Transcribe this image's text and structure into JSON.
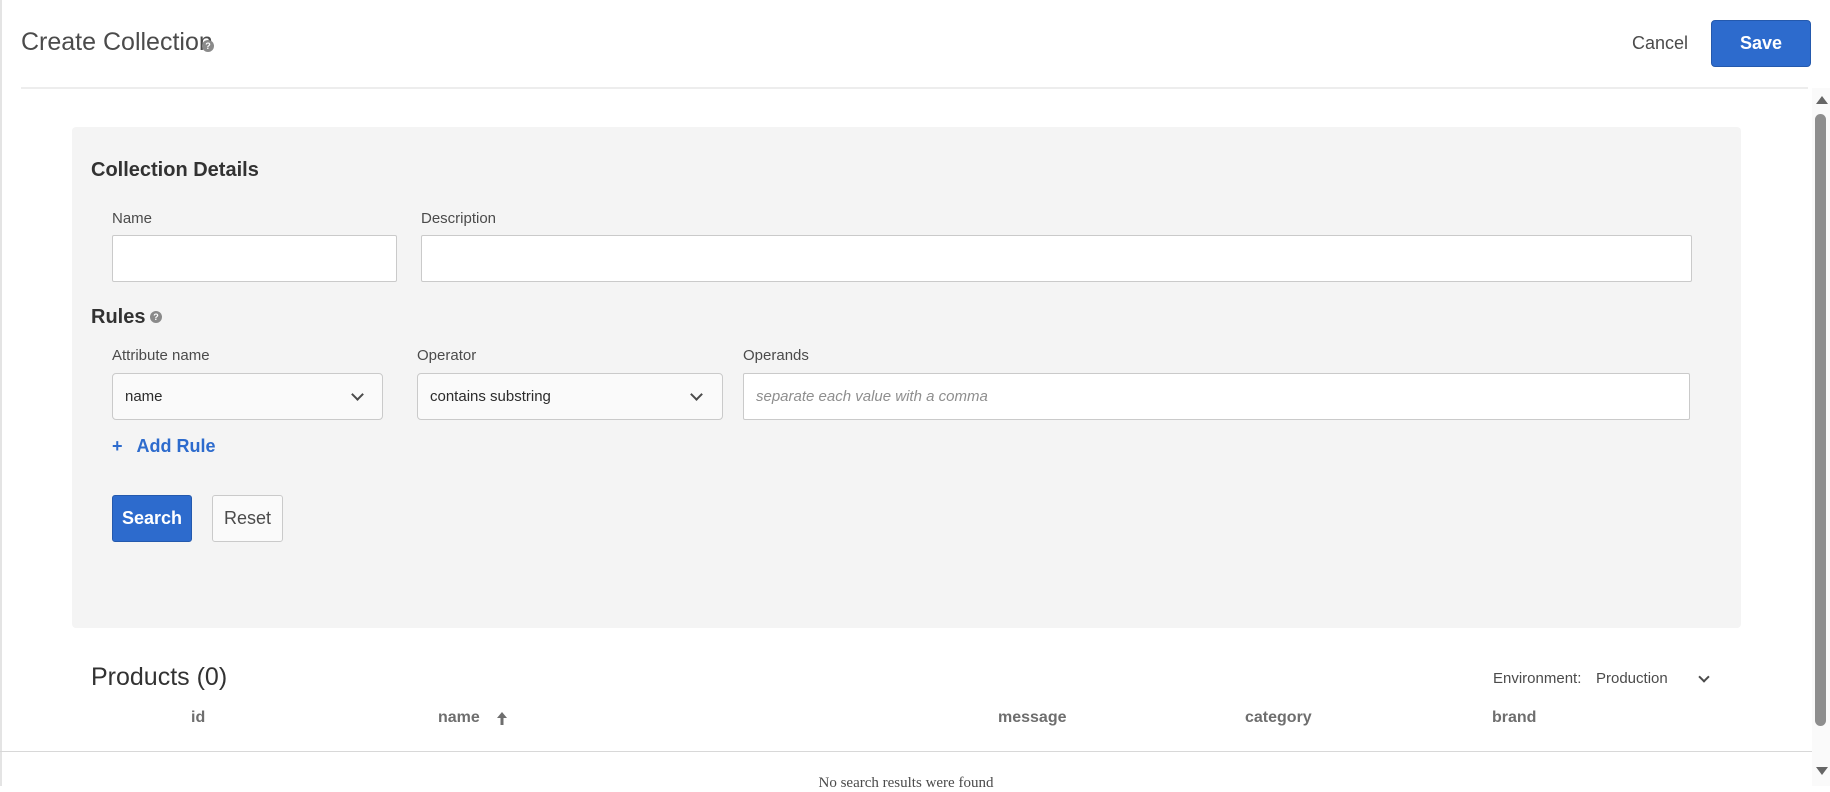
{
  "header": {
    "title": "Create Collection",
    "help_icon": "?",
    "cancel_label": "Cancel",
    "save_label": "Save"
  },
  "collection_details": {
    "title": "Collection Details",
    "name_label": "Name",
    "name_value": "",
    "description_label": "Description",
    "description_value": ""
  },
  "rules": {
    "title": "Rules",
    "help_icon": "?",
    "attribute_label": "Attribute name",
    "attribute_value": "name",
    "operator_label": "Operator",
    "operator_value": "contains substring",
    "operands_label": "Operands",
    "operands_placeholder": "separate each value with a comma",
    "add_rule_icon": "+",
    "add_rule_label": "Add Rule",
    "search_label": "Search",
    "reset_label": "Reset"
  },
  "products": {
    "title": "Products (0)",
    "environment_label": "Environment:",
    "environment_value": "Production",
    "columns": [
      "id",
      "name",
      "message",
      "category",
      "brand"
    ],
    "sorted_column": "name",
    "sort_direction": "ascending",
    "empty_message": "No search results were found"
  },
  "colors": {
    "primary": "#2d6bcd",
    "panel_bg": "#f4f4f4",
    "text": "#2c2c2c"
  }
}
